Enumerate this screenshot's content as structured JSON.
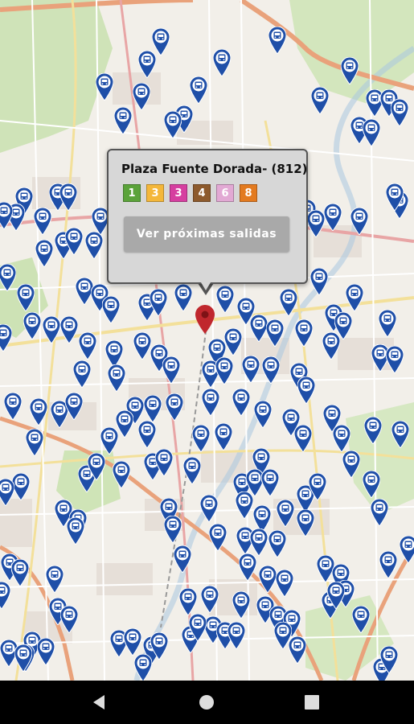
{
  "popup": {
    "title": "Plaza Fuente Dorada- (812)",
    "lines": [
      {
        "label": "1",
        "color": "#5ba33a"
      },
      {
        "label": "3",
        "color": "#f4b73a"
      },
      {
        "label": "3",
        "color": "#d63fa0"
      },
      {
        "label": "4",
        "color": "#8d5a2d"
      },
      {
        "label": "6",
        "color": "#e2a9d4"
      },
      {
        "label": "8",
        "color": "#e37a1f"
      }
    ],
    "button_label": "Ver próximas salidas"
  },
  "colors": {
    "stop_pin": "#1f4fa8",
    "selected_pin": "#c0272d",
    "map_background": "#f2efe9"
  },
  "icons": {
    "stop_marker": "bus-stop-marker-icon",
    "selected_marker": "selected-location-marker-icon",
    "back": "back-triangle-icon",
    "home": "home-circle-icon",
    "recents": "recents-square-icon"
  }
}
